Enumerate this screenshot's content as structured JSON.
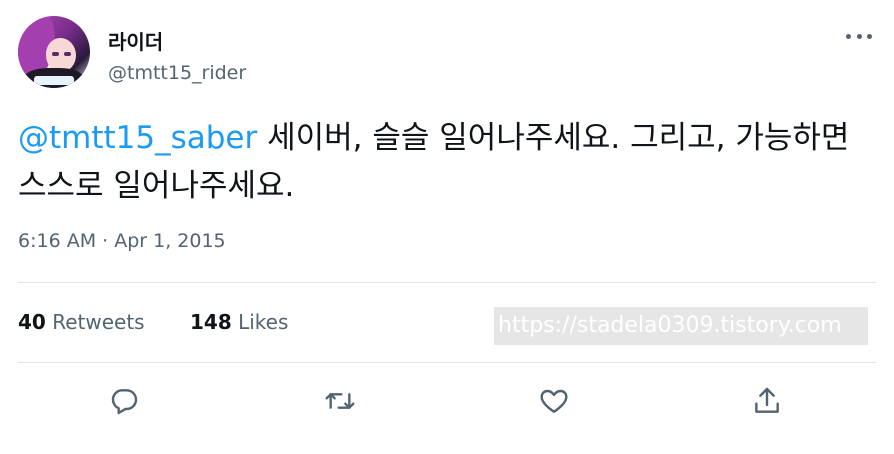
{
  "user": {
    "display_name": "라이더",
    "handle": "@tmtt15_rider"
  },
  "tweet": {
    "mention": "@tmtt15_saber",
    "text": " 세이버, 슬슬 일어나주세요. 그리고, 가능하면 스스로 일어나주세요.",
    "timestamp": "6:16 AM · Apr 1, 2015"
  },
  "stats": {
    "retweets_count": "40",
    "retweets_label": "Retweets",
    "likes_count": "148",
    "likes_label": "Likes"
  },
  "watermark": "https://stadela0309.tistory.com",
  "icons": {
    "more": "more-dots-icon",
    "reply": "reply-icon",
    "retweet": "retweet-icon",
    "like": "heart-icon",
    "share": "share-icon"
  },
  "colors": {
    "mention": "#1d9bf0",
    "secondary_text": "#536471",
    "primary_text": "#0f1419"
  }
}
